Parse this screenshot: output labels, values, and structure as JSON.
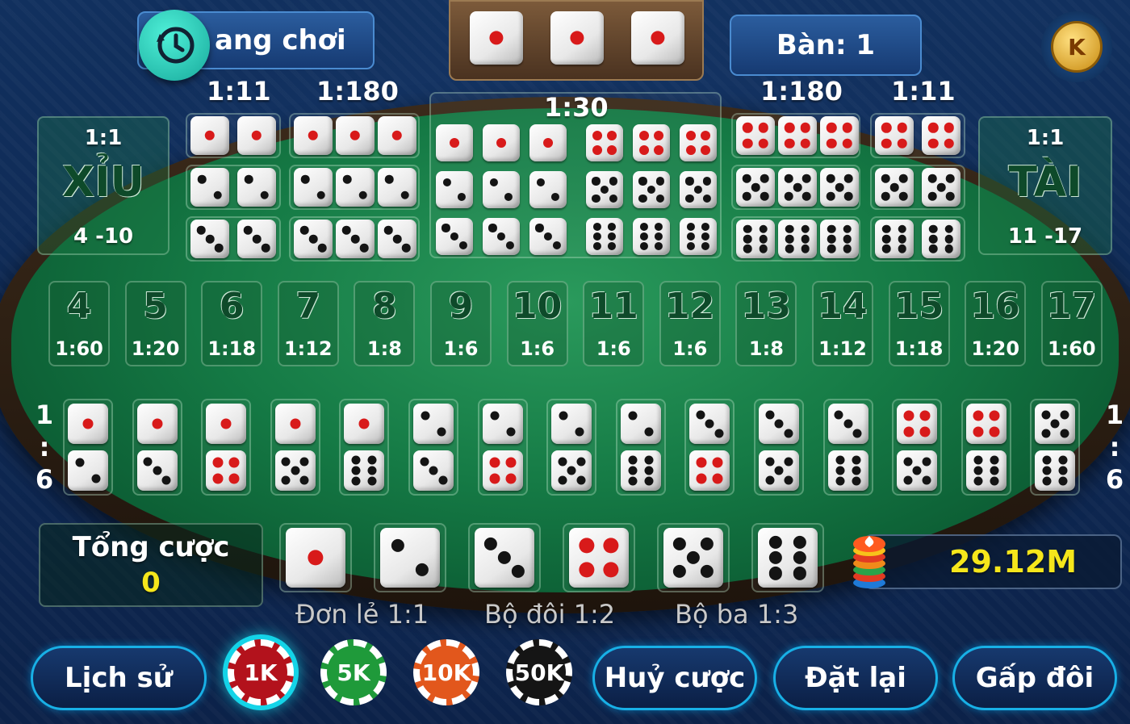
{
  "header": {
    "history_room_label": "ang chơi",
    "table_label": "Bàn: 1",
    "coin_letter": "K",
    "last_roll": [
      1,
      1,
      1
    ]
  },
  "top_odds": {
    "pair_left": "1:11",
    "triple_left": "1:180",
    "any_triple": "1:30",
    "triple_right": "1:180",
    "pair_right": "1:11"
  },
  "small_big": {
    "small": {
      "odds": "1:1",
      "name": "XỈU",
      "range": "4 -10"
    },
    "big": {
      "odds": "1:1",
      "name": "TÀI",
      "range": "11 -17"
    }
  },
  "sum_bets": [
    {
      "total": "4",
      "odds": "1:60"
    },
    {
      "total": "5",
      "odds": "1:20"
    },
    {
      "total": "6",
      "odds": "1:18"
    },
    {
      "total": "7",
      "odds": "1:12"
    },
    {
      "total": "8",
      "odds": "1:8"
    },
    {
      "total": "9",
      "odds": "1:6"
    },
    {
      "total": "10",
      "odds": "1:6"
    },
    {
      "total": "11",
      "odds": "1:6"
    },
    {
      "total": "12",
      "odds": "1:6"
    },
    {
      "total": "13",
      "odds": "1:8"
    },
    {
      "total": "14",
      "odds": "1:12"
    },
    {
      "total": "15",
      "odds": "1:18"
    },
    {
      "total": "16",
      "odds": "1:20"
    },
    {
      "total": "17",
      "odds": "1:60"
    }
  ],
  "combo_side_labels": {
    "left": [
      "1",
      ":",
      "6"
    ],
    "right": [
      "1",
      ":",
      "6"
    ]
  },
  "combos": [
    [
      1,
      2
    ],
    [
      1,
      3
    ],
    [
      1,
      4
    ],
    [
      1,
      5
    ],
    [
      1,
      6
    ],
    [
      2,
      3
    ],
    [
      2,
      4
    ],
    [
      2,
      5
    ],
    [
      2,
      6
    ],
    [
      3,
      4
    ],
    [
      3,
      5
    ],
    [
      3,
      6
    ],
    [
      4,
      5
    ],
    [
      4,
      6
    ],
    [
      5,
      6
    ]
  ],
  "total_bet": {
    "label": "Tổng cược",
    "value": "0"
  },
  "single_dice": [
    1,
    2,
    3,
    4,
    5,
    6
  ],
  "single_legend": {
    "single": "Đơn lẻ 1:1",
    "double": "Bộ đôi 1:2",
    "triple": "Bộ ba 1:3"
  },
  "balance": "29.12M",
  "buttons": {
    "history": "Lịch sử",
    "cancel": "Huỷ cược",
    "rebet": "Đặt lại",
    "double": "Gấp đôi"
  },
  "chips": [
    {
      "label": "1K",
      "color": "#b3121c",
      "selected": true
    },
    {
      "label": "5K",
      "color": "#1f9a3a",
      "selected": false
    },
    {
      "label": "10K",
      "color": "#e2571c",
      "selected": false
    },
    {
      "label": "50K",
      "color": "#151515",
      "selected": false
    }
  ],
  "colors": {
    "felt": "#157a45",
    "accent": "#18b0e6",
    "balance": "#f5e61b",
    "total_value": "#f5e61b"
  }
}
